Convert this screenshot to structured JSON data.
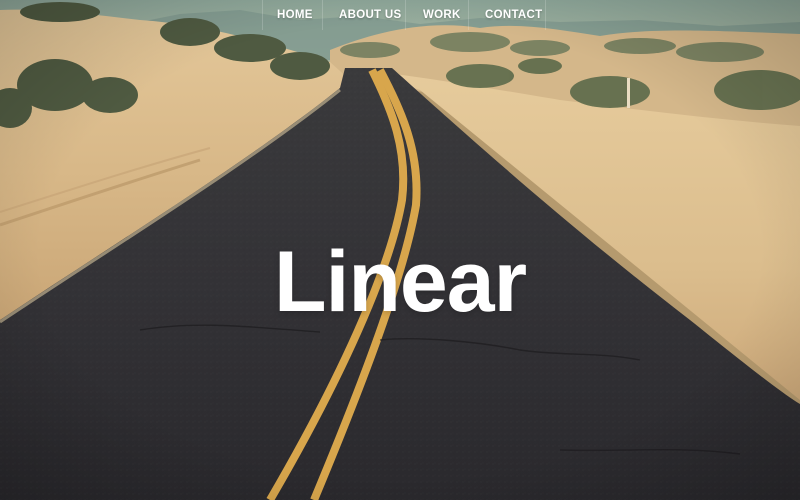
{
  "nav": {
    "items": [
      {
        "label": "HOME"
      },
      {
        "label": "ABOUT US"
      },
      {
        "label": "WORK"
      },
      {
        "label": "CONTACT"
      }
    ]
  },
  "hero": {
    "title": "Linear",
    "background_description_icon": "desert-road-image"
  },
  "colors": {
    "sky": "#8fa89c",
    "sand": "#d9b98a",
    "asphalt": "#2d2c30",
    "road_line": "#d9a94e",
    "text": "#ffffff"
  }
}
